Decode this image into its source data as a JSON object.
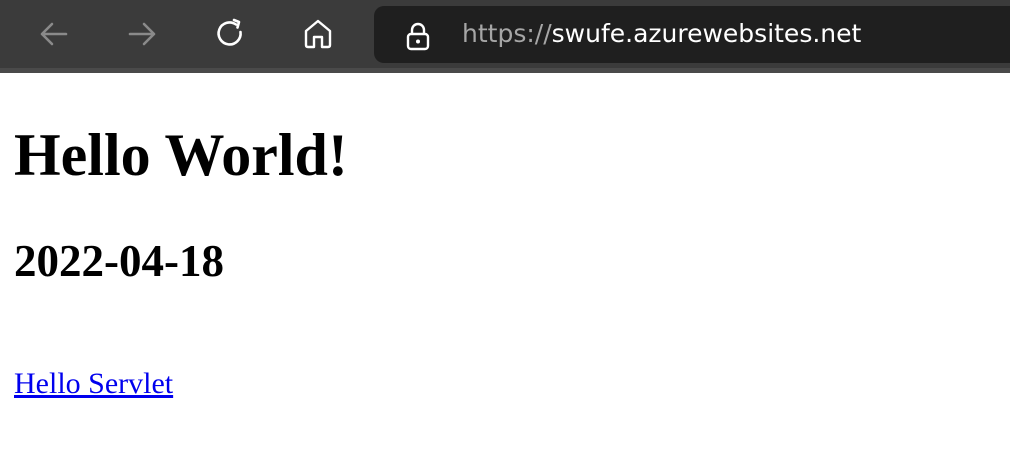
{
  "browser": {
    "url_scheme": "https://",
    "url_host": "swufe.azurewebsites.net",
    "icons": {
      "back": "back-arrow-icon",
      "forward": "forward-arrow-icon",
      "reload": "reload-icon",
      "home": "home-icon",
      "security": "lock-icon"
    },
    "colors": {
      "toolbar_bg": "#3b3b3b",
      "address_bg": "#1f1f1f",
      "scheme_text": "#a6a6a6",
      "host_text": "#ffffff"
    }
  },
  "page": {
    "heading": "Hello World!",
    "date": "2022-04-18",
    "link_text": "Hello Servlet",
    "colors": {
      "link": "#0000ee",
      "text": "#000000"
    }
  }
}
